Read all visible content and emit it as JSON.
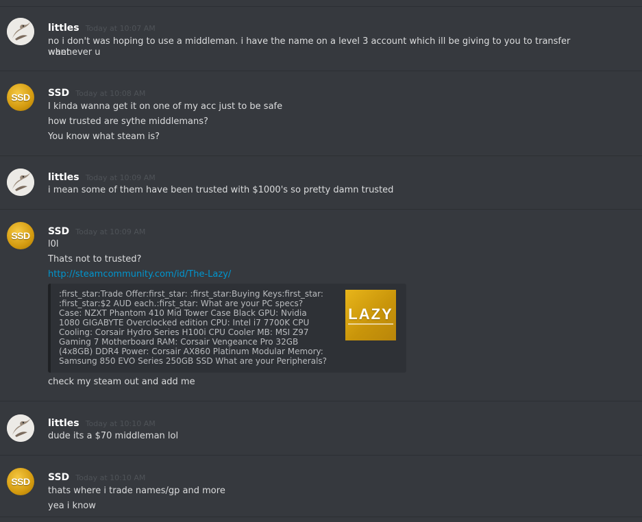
{
  "messages": [
    {
      "author": "littles",
      "timestamp": "Today at 10:07 AM",
      "lines": [
        "no i don't was hoping to use a middleman. i have the name on a level 3 account which ill be giving to you to transfer whenever u",
        "want"
      ]
    },
    {
      "author": "SSD",
      "timestamp": "Today at 10:08 AM",
      "lines": [
        "I kinda wanna get it on one of my acc just to be safe",
        "how trusted are sythe middlemans?",
        "You know what steam is?"
      ]
    },
    {
      "author": "littles",
      "timestamp": "Today at 10:09 AM",
      "lines": [
        "i mean some of them have been trusted with $1000's so pretty damn trusted"
      ]
    },
    {
      "author": "SSD",
      "timestamp": "Today at 10:09 AM",
      "lines": [
        "l0l",
        "Thats not to trusted?",
        "http://steamcommunity.com/id/The-Lazy/",
        "check my steam out and add me"
      ],
      "embed": {
        "description": ":first_star:Trade Offer:first_star: :first_star:Buying Keys:first_star: :first_star:$2 AUD each.:first_star: What are your PC specs? Case: NZXT Phantom 410 Mid Tower Case Black GPU: Nvidia 1080 GIGABYTE Overclocked edition CPU: Intel i7 7700K CPU Cooling: Corsair Hydro Series H100i CPU Cooler MB: MSI Z97 Gaming 7 Motherboard RAM: Corsair Vengeance Pro 32GB (4x8GB) DDR4 Power: Corsair AX860 Platinum Modular Memory: Samsung 850 EVO Series 250GB SSD What are your Peripherals?",
        "thumbnail_text": "LAZY"
      }
    },
    {
      "author": "littles",
      "timestamp": "Today at 10:10 AM",
      "lines": [
        "dude its a $70 middleman lol"
      ]
    },
    {
      "author": "SSD",
      "timestamp": "Today at 10:10 AM",
      "lines": [
        "thats where i trade names/gp and more",
        "yea i know"
      ]
    }
  ],
  "avatars": {
    "ssd_text": "SSD"
  },
  "colors": {
    "background": "#36393e",
    "link": "#0096cf",
    "timestamp": "#4f5358"
  }
}
